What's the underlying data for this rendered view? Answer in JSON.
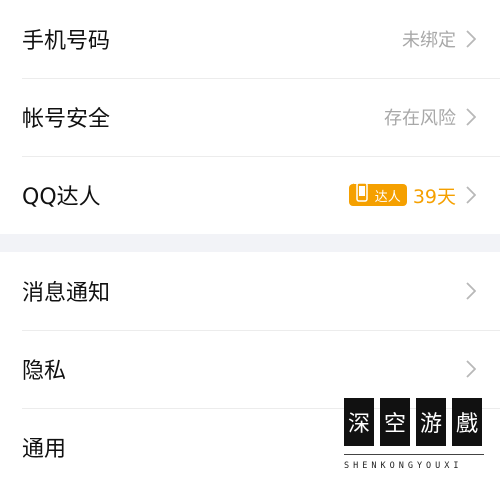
{
  "group1": {
    "rows": [
      {
        "label": "手机号码",
        "value": "未绑定"
      },
      {
        "label": "帐号安全",
        "value": "存在风险"
      },
      {
        "label": "QQ达人",
        "badge_text": "达人",
        "value": "39天"
      }
    ]
  },
  "group2": {
    "rows": [
      {
        "label": "消息通知"
      },
      {
        "label": "隐私"
      },
      {
        "label": "通用"
      }
    ]
  },
  "watermark": {
    "chars": [
      "深",
      "空",
      "游",
      "戲"
    ],
    "subtitle": "SHENKONGYOUXI"
  },
  "colors": {
    "accent_gold": "#f5a000",
    "muted_text": "#a8a8a8",
    "separator_bg": "#f2f3f7"
  },
  "icons": {
    "chevron": "chevron-right-icon",
    "badge": "qq-talent-phone-icon"
  }
}
